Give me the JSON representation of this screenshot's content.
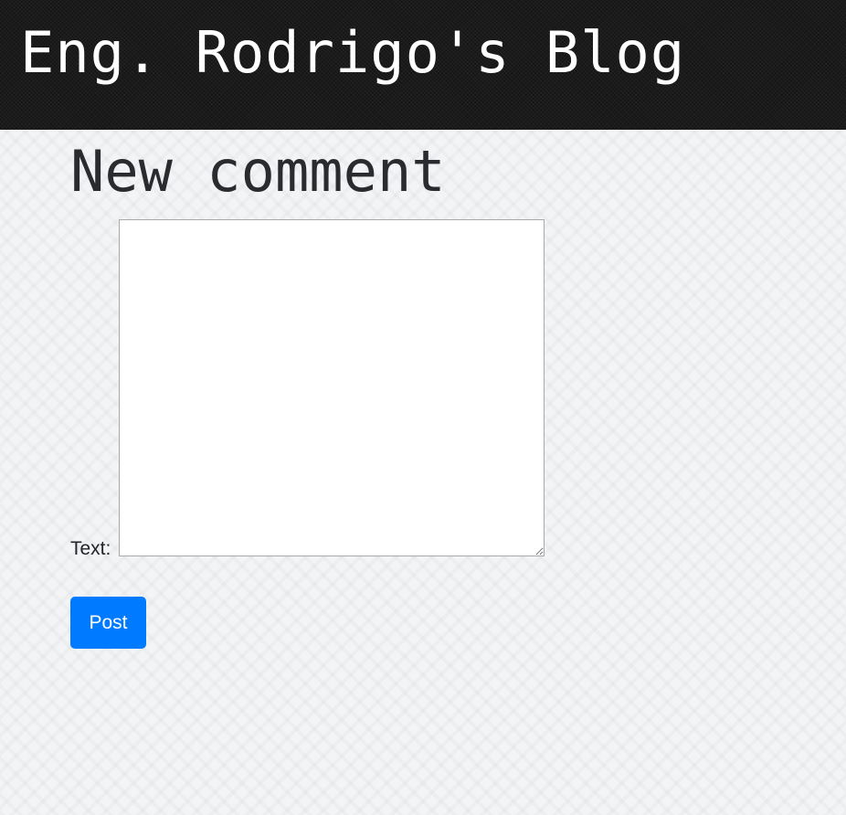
{
  "header": {
    "site_title": "Eng. Rodrigo's Blog"
  },
  "main": {
    "heading": "New comment",
    "form": {
      "text_label": "Text:",
      "text_value": "",
      "post_button_label": "Post"
    }
  },
  "colors": {
    "header_background": "#161616",
    "page_background": "#f3f4f6",
    "button_primary": "#007bff"
  }
}
